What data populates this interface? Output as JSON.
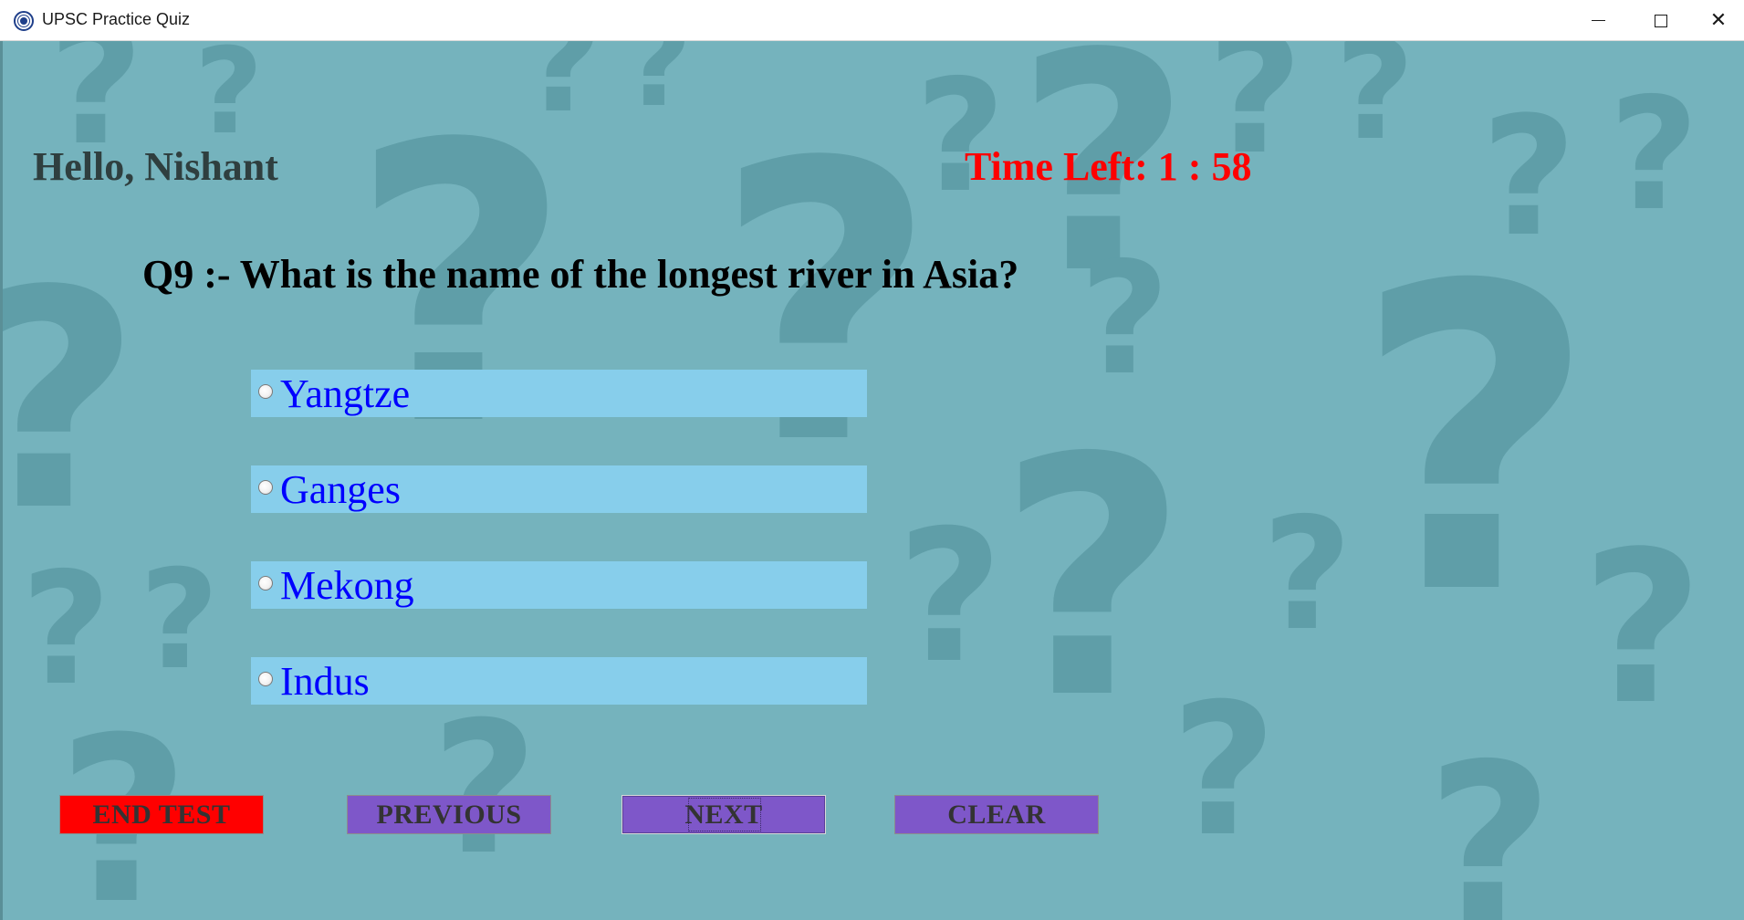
{
  "window": {
    "title": "UPSC Practice Quiz",
    "icon": "app-logo-icon",
    "controls": [
      "minimize-icon",
      "maximize-icon",
      "close-icon"
    ],
    "close_glyph": "✕"
  },
  "header": {
    "greeting": "Hello, Nishant",
    "timer": "Time Left: 1 : 58"
  },
  "question": {
    "text": "Q9 :- What is the name of the longest river in Asia?"
  },
  "options": [
    {
      "label": "Yangtze",
      "selected": false
    },
    {
      "label": "Ganges",
      "selected": false
    },
    {
      "label": "Mekong",
      "selected": false
    },
    {
      "label": "Indus",
      "selected": false
    }
  ],
  "buttons": {
    "end_test": "END TEST",
    "previous": "PREVIOUS",
    "next": "NEXT",
    "clear": "CLEAR"
  },
  "colors": {
    "background": "#75b3bd",
    "background_pattern": "#5f9ea8",
    "timer": "#ff0000",
    "option_background": "#87ceeb",
    "option_text": "#0000ff",
    "end_button": "#ff0000",
    "nav_button": "#7e57c9"
  }
}
